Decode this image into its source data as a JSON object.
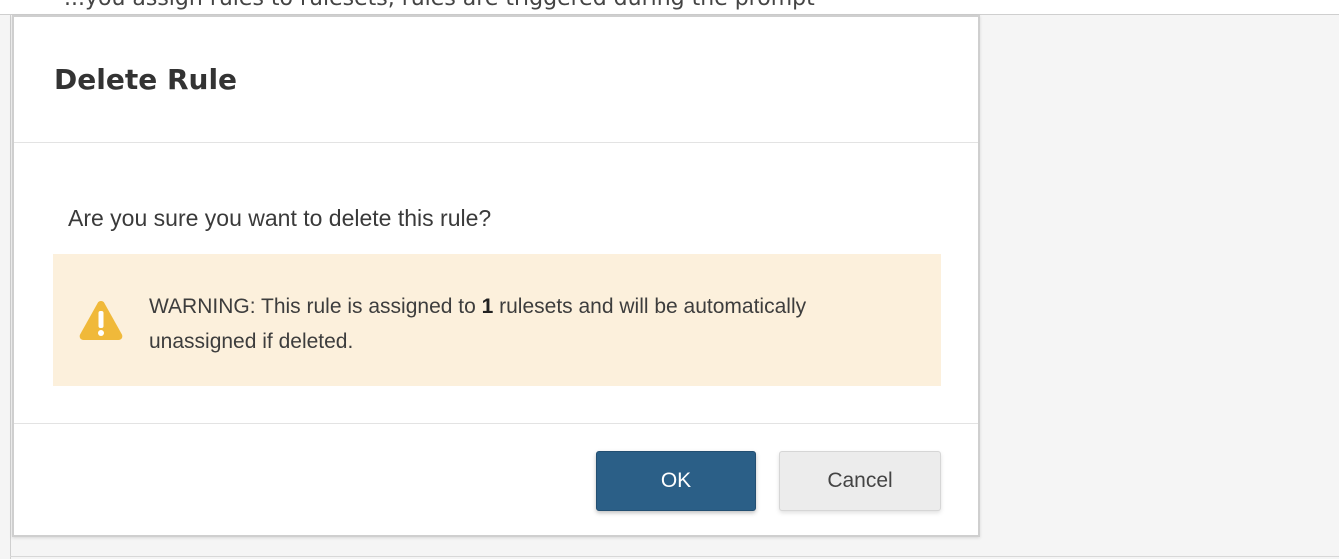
{
  "background_text": "...you assign rules to rulesets, rules are triggered during the prompt",
  "modal": {
    "title": "Delete Rule",
    "question": "Are you sure you want to delete this rule?",
    "warning": {
      "prefix": "WARNING: This rule is assigned to ",
      "count": "1",
      "suffix": " rulesets and will be automatically unassigned if deleted.",
      "icon": "warning-triangle-icon",
      "background_color": "#fcf0dc",
      "icon_color": "#f0b93a"
    },
    "buttons": {
      "ok": "OK",
      "cancel": "Cancel"
    },
    "ok_color": "#2b5f87"
  }
}
